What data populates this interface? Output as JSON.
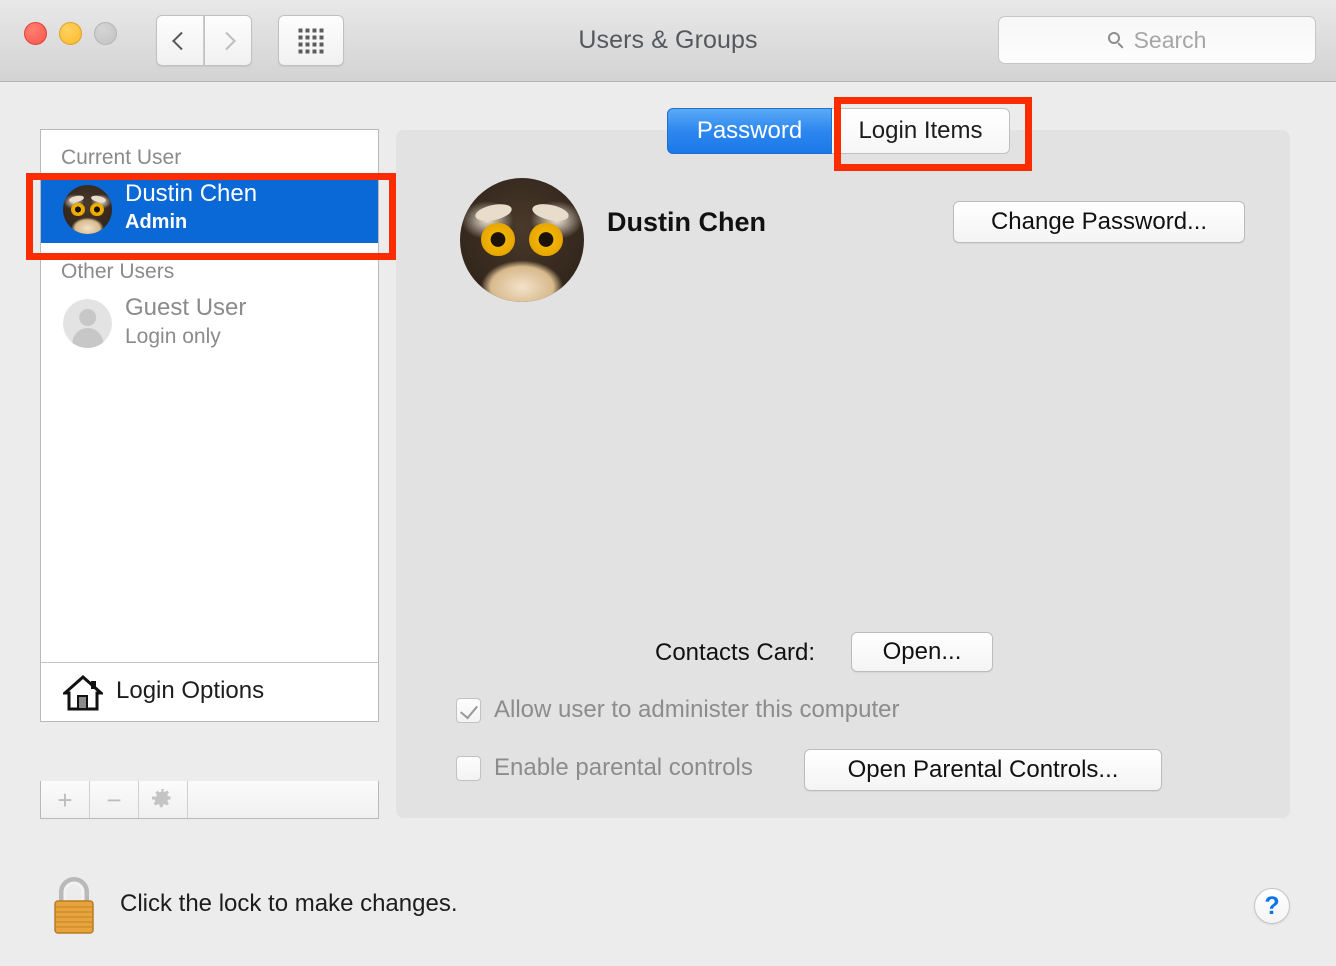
{
  "window": {
    "title": "Users & Groups",
    "traffic_lights": [
      "close",
      "minimize",
      "zoom"
    ]
  },
  "toolbar": {
    "back_icon": "chevron-left-icon",
    "forward_icon": "chevron-right-icon",
    "grid_icon": "show-all-grid-icon",
    "search": {
      "placeholder": "Search",
      "value": "",
      "icon": "search-icon"
    }
  },
  "sidebar": {
    "groups": [
      {
        "header": "Current User",
        "users": [
          {
            "name": "Dustin Chen",
            "role": "Admin",
            "avatar": "owl-photo-avatar",
            "selected": true
          }
        ]
      },
      {
        "header": "Other Users",
        "users": [
          {
            "name": "Guest User",
            "role": "Login only",
            "avatar": "generic-person-avatar",
            "selected": false
          }
        ]
      }
    ],
    "login_options": {
      "label": "Login Options",
      "icon": "house-icon"
    },
    "toolbar": {
      "add_label": "+",
      "remove_label": "−",
      "gear_icon": "gear-icon",
      "disabled": true
    }
  },
  "content": {
    "tabs": [
      {
        "label": "Password",
        "selected": true
      },
      {
        "label": "Login Items",
        "selected": false,
        "highlighted": true
      }
    ],
    "user": {
      "full_name": "Dustin Chen",
      "avatar": "owl-photo-avatar"
    },
    "change_password_button": "Change Password...",
    "contacts_card": {
      "label": "Contacts Card:",
      "open_button": "Open..."
    },
    "options": [
      {
        "label": "Allow user to administer this computer",
        "checked": true,
        "disabled": true
      },
      {
        "label": "Enable parental controls",
        "checked": false,
        "disabled": true
      }
    ],
    "parental_button": "Open Parental Controls..."
  },
  "footer": {
    "lock_icon": "locked-padlock-icon",
    "lock_text": "Click the lock to make changes.",
    "help_label": "?"
  },
  "colors": {
    "selection_blue": "#0a69d7",
    "tab_blue": "#2d87ef",
    "annotation_red": "#fb2d00",
    "help_blue": "#0b74e8",
    "panel_gray": "#e2e2e2"
  }
}
